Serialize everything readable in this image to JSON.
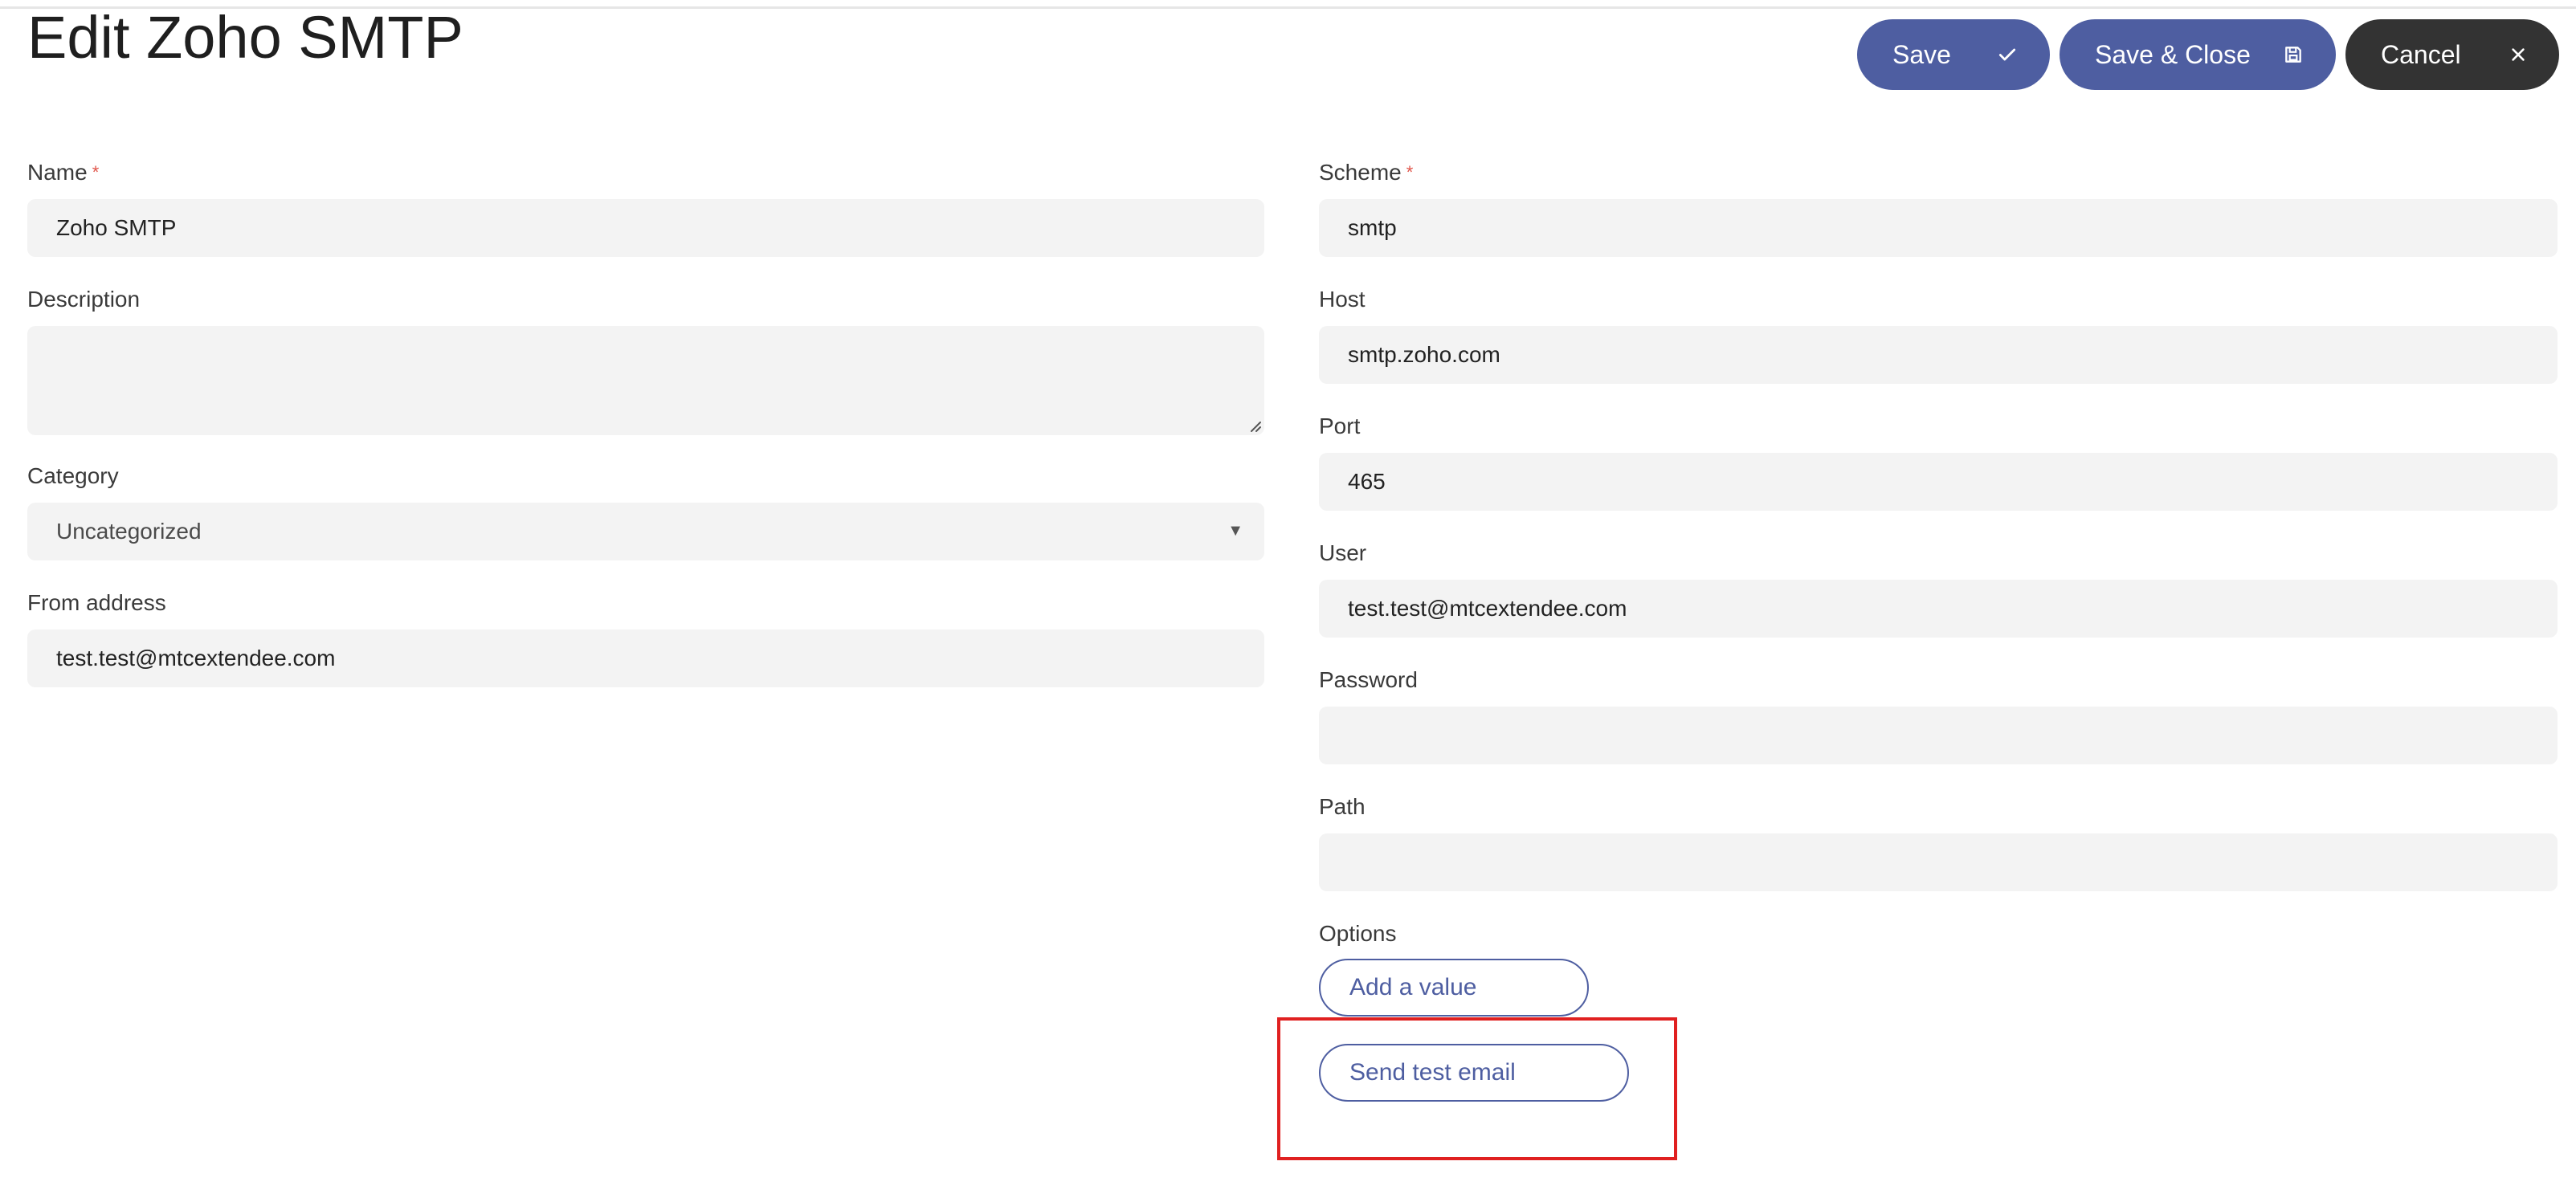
{
  "header": {
    "title": "Edit Zoho SMTP"
  },
  "toolbar": {
    "save_label": "Save",
    "save_close_label": "Save & Close",
    "cancel_label": "Cancel",
    "icons": {
      "save": "check-icon",
      "save_close": "floppy-disk-icon",
      "cancel": "close-icon"
    },
    "colors": {
      "primary": "#4e5ea1",
      "dark": "#333333"
    }
  },
  "form_left": {
    "name": {
      "label": "Name",
      "required_mark": "*",
      "value": "Zoho SMTP"
    },
    "description": {
      "label": "Description",
      "value": ""
    },
    "category": {
      "label": "Category",
      "selected": "Uncategorized",
      "caret": "▼"
    },
    "from_address": {
      "label": "From address",
      "value": "test.test@mtcextendee.com"
    }
  },
  "form_right": {
    "scheme": {
      "label": "Scheme",
      "required_mark": "*",
      "value": "smtp"
    },
    "host": {
      "label": "Host",
      "value": "smtp.zoho.com"
    },
    "port": {
      "label": "Port",
      "value": "465"
    },
    "user": {
      "label": "User",
      "value": "test.test@mtcextendee.com"
    },
    "password": {
      "label": "Password",
      "value": ""
    },
    "path": {
      "label": "Path",
      "value": ""
    },
    "options": {
      "label": "Options",
      "add_value_label": "Add a value"
    },
    "send_test_label": "Send test email"
  },
  "annotation": {
    "highlight_color": "#e02020"
  }
}
